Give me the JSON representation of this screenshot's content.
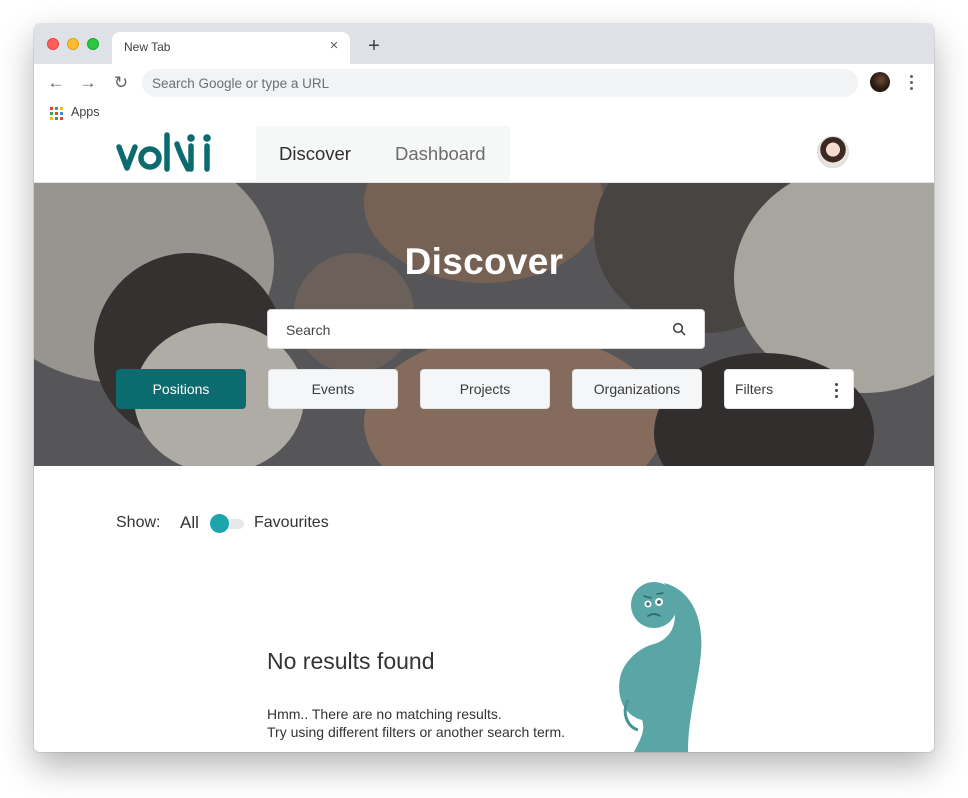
{
  "browser": {
    "tab_title": "New Tab",
    "tab_close_glyph": "×",
    "new_tab_glyph": "+",
    "back_glyph": "←",
    "forward_glyph": "→",
    "reload_glyph": "↻",
    "omnibox_placeholder": "Search Google or type a URL",
    "bookmarks": {
      "apps_label": "Apps"
    }
  },
  "app": {
    "logo_text": "volii",
    "brand_color": "#0c6b6f",
    "nav": {
      "discover": "Discover",
      "dashboard": "Dashboard"
    }
  },
  "hero": {
    "title": "Discover",
    "search_placeholder": "Search",
    "categories": {
      "positions": "Positions",
      "events": "Events",
      "projects": "Projects",
      "organizations": "Organizations"
    },
    "active_category": "Positions",
    "filters_label": "Filters"
  },
  "show": {
    "label": "Show:",
    "all": "All",
    "favourites": "Favourites",
    "toggle_state": "All"
  },
  "empty_state": {
    "title": "No results found",
    "line1": "Hmm.. There are no matching results.",
    "line2": "Try using different filters or another search term."
  }
}
